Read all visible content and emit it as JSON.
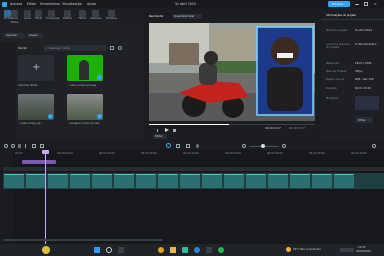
{
  "window": {
    "title": "5s abril 2024",
    "export_label": "Exportar"
  },
  "menu": [
    "Arquivo",
    "Editar",
    "Ferramentas",
    "Visualização",
    "Ajuda"
  ],
  "toolbar": [
    {
      "label": "Mídia"
    },
    {
      "label": "Stock Media"
    },
    {
      "label": "Áudio"
    },
    {
      "label": "Título"
    },
    {
      "label": "Transições"
    },
    {
      "label": "Efeitos"
    },
    {
      "label": "Filtros"
    },
    {
      "label": "Adesivos"
    },
    {
      "label": "Modelos"
    }
  ],
  "media": {
    "import_label": "Importar",
    "record_label": "Gravar",
    "search_placeholder": "Pesquisar mídia",
    "folder_label": "Padrão",
    "items": [
      {
        "caption": "Importar Mídia",
        "kind": "import"
      },
      {
        "caption": "...vídeo amigo g2.jpeg",
        "kind": "green"
      },
      {
        "caption": "...video amigo g2...",
        "kind": "street"
      },
      {
        "caption": "...sonagem modo de tela",
        "kind": "street2"
      }
    ]
  },
  "player": {
    "tabs": [
      "Reprodutor",
      "Qualidade total"
    ],
    "time": "00:00:13:07",
    "duration": "00:00:27:07",
    "edit_label": "Editar"
  },
  "properties": {
    "title": "Informações do projeto",
    "rows": [
      {
        "label": "Nome do projeto",
        "value": "5s abril 2024"
      },
      {
        "label": "Local dos arquivos do projeto",
        "value": "D:/Wondershare..."
      },
      {
        "label": "Resolução",
        "value": "1920 x 1080"
      },
      {
        "label": "Taxa de Frames",
        "value": "30fps"
      },
      {
        "label": "Espaço de Cor",
        "value": "SDR - Rec.709"
      },
      {
        "label": "Duração",
        "value": "00:01:13:20"
      },
      {
        "label": "Miniatura",
        "value": ""
      }
    ],
    "edit_button": "Editar"
  },
  "timeline": {
    "ruler": [
      "00:00",
      "00:00:05:00",
      "00:00:10:00",
      "00:00:15:00",
      "00:00:20:00",
      "00:00:25:00",
      "00:00:30:00",
      "00:00:35:00",
      "00:00:40:00"
    ],
    "clips_count_shown": 16
  },
  "taskbar": {
    "weather": "29°C Parc ensolarado",
    "time": "10:45",
    "date": "20/04/2024"
  },
  "colors": {
    "accent": "#2ea8ff",
    "clip_teal": "#2b6f73",
    "clip_bar": "#4fc4c4",
    "playhead": "#c9a6ff",
    "green": "#1db100"
  }
}
